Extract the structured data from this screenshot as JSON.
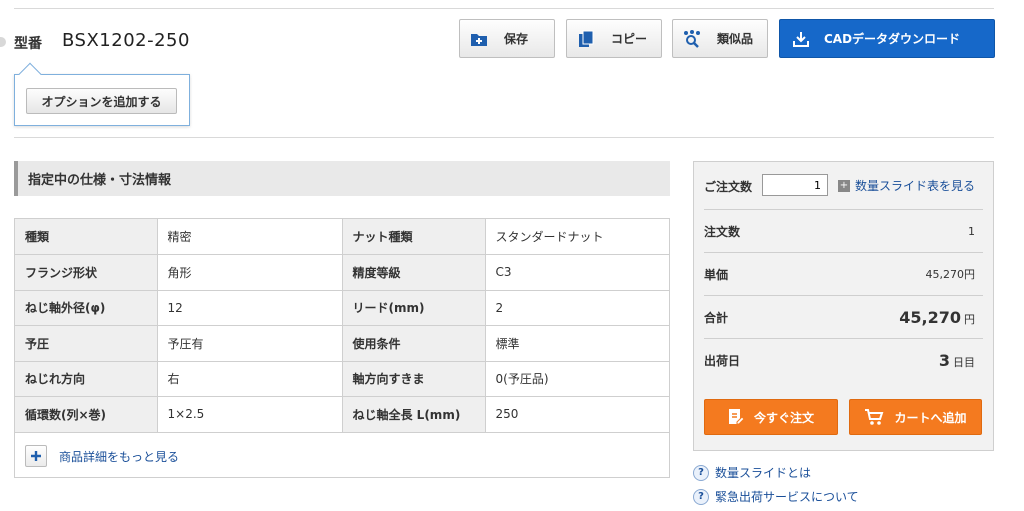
{
  "product": {
    "model_label": "型番",
    "model_number": "BSX1202-250",
    "option_button": "オプションを追加する"
  },
  "toolbar": {
    "save": "保存",
    "copy": "コピー",
    "similar": "類似品",
    "cad_download": "CADデータダウンロード"
  },
  "spec": {
    "heading": "指定中の仕様・寸法情報",
    "rows": [
      {
        "l1": "種類",
        "v1": "精密",
        "l2": "ナット種類",
        "v2": "スタンダードナット"
      },
      {
        "l1": "フランジ形状",
        "v1": "角形",
        "l2": "精度等級",
        "v2": "C3"
      },
      {
        "l1": "ねじ軸外径(φ)",
        "v1": "12",
        "l2": "リード(mm)",
        "v2": "2"
      },
      {
        "l1": "予圧",
        "v1": "予圧有",
        "l2": "使用条件",
        "v2": "標準"
      },
      {
        "l1": "ねじれ方向",
        "v1": "右",
        "l2": "軸方向すきま",
        "v2": "0(予圧品)"
      },
      {
        "l1": "循環数(列×巻)",
        "v1": "1×2.5",
        "l2": "ねじ軸全長 L(mm)",
        "v2": "250"
      }
    ],
    "more_link": "商品詳細をもっと見る"
  },
  "order": {
    "qty_label": "ご注文数",
    "qty_value": "1",
    "qty_slide_link": "数量スライド表を見る",
    "rows": {
      "count_label": "注文数",
      "count_value": "1",
      "unit_price_label": "単価",
      "unit_price_value": "45,270円",
      "total_label": "合計",
      "total_value": "45,270",
      "total_unit": "円",
      "ship_label": "出荷日",
      "ship_value": "3",
      "ship_unit": "日目"
    },
    "buy_now": "今すぐ注文",
    "add_cart": "カートへ追加"
  },
  "help": {
    "link1": "数量スライドとは",
    "link2": "緊急出荷サービスについて",
    "icon_char": "?"
  },
  "colors": {
    "primary_blue": "#1668c9",
    "order_orange": "#f47a1f",
    "link_blue": "#1a4f99"
  }
}
